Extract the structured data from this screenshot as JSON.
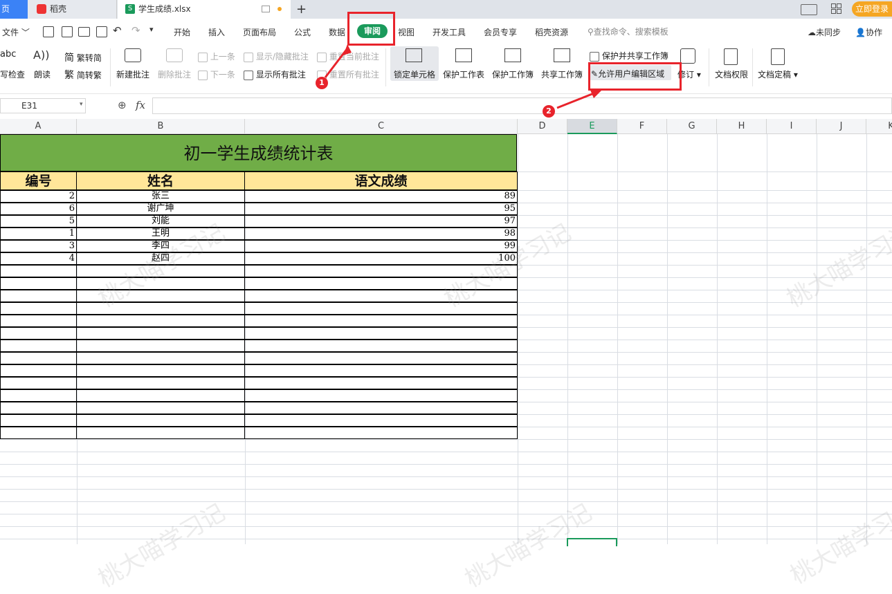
{
  "tabs": {
    "home_label": "页",
    "daoke_label": "稻壳",
    "file_label": "学生成绩.xlsx",
    "new_tab": "+",
    "login_button": "立即登录"
  },
  "menu": {
    "file": "文件",
    "items": [
      "开始",
      "插入",
      "页面布局",
      "公式",
      "数据",
      "审阅",
      "视图",
      "开发工具",
      "会员专享",
      "稻壳资源"
    ],
    "search_placeholder": "查找命令、搜索模板",
    "sync": "未同步",
    "collab": "协作"
  },
  "ribbon": {
    "spellcheck": "拼写检查",
    "spellcheck_abbr": "abc",
    "read_aloud": "朗读",
    "trad_to_simp": "繁转简",
    "simp_to_trad": "简转繁",
    "new_comment": "新建批注",
    "delete_comment": "删除批注",
    "prev": "上一条",
    "next": "下一条",
    "show_hide_comment": "显示/隐藏批注",
    "show_all_comments": "显示所有批注",
    "reset_current_comment": "重置当前批注",
    "reset_all_comments": "重置所有批注",
    "lock_cell": "锁定单元格",
    "protect_sheet": "保护工作表",
    "protect_workbook": "保护工作簿",
    "share_workbook": "共享工作簿",
    "protect_and_share": "保护并共享工作簿",
    "allow_edit_ranges": "允许用户编辑区域",
    "track_changes": "修订",
    "doc_permissions": "文档权限",
    "doc_finalize": "文档定稿"
  },
  "formula_bar": {
    "name_box": "E31",
    "fx": "fx",
    "formula": ""
  },
  "sheet": {
    "columns": [
      "A",
      "B",
      "C",
      "D",
      "E",
      "F",
      "G",
      "H",
      "I",
      "J",
      "K"
    ],
    "selected_column": "E",
    "title": "初一学生成绩统计表",
    "headers": [
      "编号",
      "姓名",
      "语文成绩"
    ],
    "rows": [
      {
        "id": "2",
        "name": "张三",
        "score": "89"
      },
      {
        "id": "6",
        "name": "谢广坤",
        "score": "95"
      },
      {
        "id": "5",
        "name": "刘能",
        "score": "97"
      },
      {
        "id": "1",
        "name": "王明",
        "score": "98"
      },
      {
        "id": "3",
        "name": "李四",
        "score": "99"
      },
      {
        "id": "4",
        "name": "赵四",
        "score": "100"
      }
    ]
  },
  "annotations": {
    "badge1": "1",
    "badge2": "2",
    "color": "#e8232b"
  },
  "watermark": "桃大喵学习记"
}
